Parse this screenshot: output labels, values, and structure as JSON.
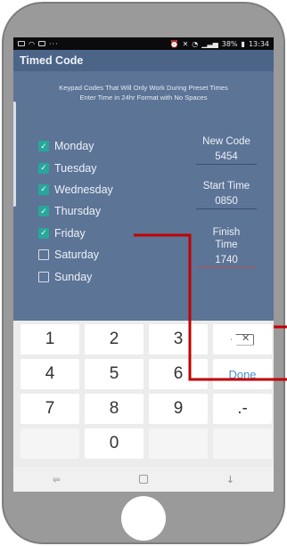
{
  "status_bar": {
    "left_dots": "···",
    "battery": "38%",
    "time": "13:34"
  },
  "app_bar": {
    "title": "Timed Code"
  },
  "description": {
    "line1": "Keypad Codes That Will Only Work During Preset Times",
    "line2": "Enter Time in 24hr Format with No Spaces"
  },
  "days": [
    {
      "label": "Monday",
      "checked": true
    },
    {
      "label": "Tuesday",
      "checked": true
    },
    {
      "label": "Wednesday",
      "checked": true
    },
    {
      "label": "Thursday",
      "checked": true
    },
    {
      "label": "Friday",
      "checked": true
    },
    {
      "label": "Saturday",
      "checked": false
    },
    {
      "label": "Sunday",
      "checked": false
    }
  ],
  "fields": {
    "new_code": {
      "label": "New Code",
      "value": "5454"
    },
    "start_time": {
      "label": "Start Time",
      "value": "0850"
    },
    "finish_time": {
      "label_line1": "Finish",
      "label_line2": "Time",
      "value": "1740"
    }
  },
  "keypad": {
    "keys": [
      "1",
      "2",
      "3",
      "4",
      "5",
      "6",
      "7",
      "8",
      "9",
      "0"
    ],
    "backspace_icon": "backspace-icon",
    "done_label": "Done",
    "symbols_label": ".-"
  },
  "nav": {
    "back_icon": "recent-apps-icon",
    "home_icon": "home-square-icon",
    "down_icon": "down-arrow-icon",
    "recent_glyph": "⥫",
    "down_glyph": "↓"
  },
  "colors": {
    "screen_bg": "#5c7496",
    "app_bar": "#4b6488",
    "checkbox": "#27a79a",
    "done": "#4a8ed0",
    "annotation": "#c00000"
  }
}
